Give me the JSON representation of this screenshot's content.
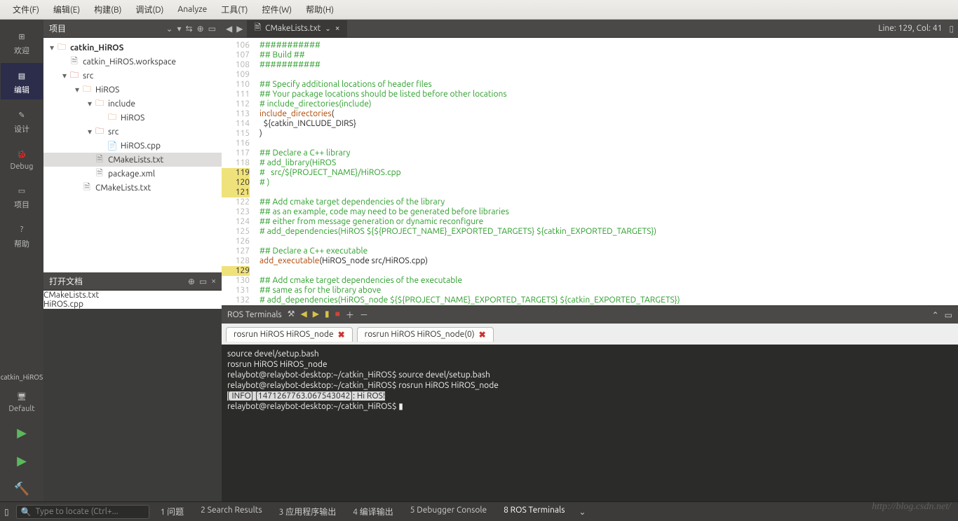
{
  "menubar": [
    "文件(F)",
    "编辑(E)",
    "构建(B)",
    "调试(D)",
    "Analyze",
    "工具(T)",
    "控件(W)",
    "帮助(H)"
  ],
  "leftbar": {
    "items": [
      "欢迎",
      "编辑",
      "设计",
      "Debug",
      "项目",
      "帮助"
    ],
    "project_label": "catkin_HiROS",
    "config_label": "Default"
  },
  "project_panel": {
    "title": "项目"
  },
  "tree": [
    {
      "d": 0,
      "exp": "▾",
      "ic": "fold-o",
      "t": "catkin_HiROS",
      "bold": true
    },
    {
      "d": 1,
      "exp": "",
      "ic": "fil",
      "t": "catkin_HiROS.workspace"
    },
    {
      "d": 1,
      "exp": "▾",
      "ic": "fold-r",
      "t": "src"
    },
    {
      "d": 2,
      "exp": "▾",
      "ic": "fold-o",
      "t": "HiROS"
    },
    {
      "d": 3,
      "exp": "▾",
      "ic": "fold-o",
      "t": "include"
    },
    {
      "d": 4,
      "exp": "",
      "ic": "fold-o",
      "t": "HiROS"
    },
    {
      "d": 3,
      "exp": "▾",
      "ic": "fold-r",
      "t": "src"
    },
    {
      "d": 4,
      "exp": "",
      "ic": "cpp",
      "t": "HiROS.cpp"
    },
    {
      "d": 3,
      "exp": "",
      "ic": "fil",
      "t": "CMakeLists.txt",
      "sel": true
    },
    {
      "d": 3,
      "exp": "",
      "ic": "fil",
      "t": "package.xml"
    },
    {
      "d": 2,
      "exp": "",
      "ic": "fil",
      "t": "CMakeLists.txt"
    }
  ],
  "open_docs": {
    "title": "打开文档",
    "items": [
      "CMakeLists.txt",
      "HiROS.cpp"
    ]
  },
  "tab": {
    "name": "CMakeLists.txt"
  },
  "status": {
    "text": "Line: 129, Col: 41"
  },
  "code": {
    "first_line": 106,
    "yellow": [
      119,
      120,
      121,
      129
    ],
    "lines": [
      {
        "cls": "c-cmt",
        "t": "###########"
      },
      {
        "cls": "c-cmt",
        "t": "## Build ##"
      },
      {
        "cls": "c-cmt",
        "t": "###########"
      },
      {
        "cls": "",
        "t": ""
      },
      {
        "cls": "c-cmt",
        "t": "## Specify additional locations of header files"
      },
      {
        "cls": "c-cmt",
        "t": "## Your package locations should be listed before other locations"
      },
      {
        "cls": "c-cmt",
        "t": "# include_directories(include)"
      },
      {
        "cls": "",
        "t": "",
        "frag": [
          {
            "c": "c-kw",
            "t": "include_directories"
          },
          {
            "c": "",
            "t": "("
          }
        ]
      },
      {
        "cls": "",
        "t": "  ${catkin_INCLUDE_DIRS}"
      },
      {
        "cls": "",
        "t": ")"
      },
      {
        "cls": "",
        "t": ""
      },
      {
        "cls": "c-cmt",
        "t": "## Declare a C++ library"
      },
      {
        "cls": "c-cmt",
        "t": "# add_library(HiROS"
      },
      {
        "cls": "c-cmt",
        "t": "#   src/${PROJECT_NAME}/HiROS.cpp"
      },
      {
        "cls": "c-cmt",
        "t": "# )"
      },
      {
        "cls": "",
        "t": ""
      },
      {
        "cls": "c-cmt",
        "t": "## Add cmake target dependencies of the library"
      },
      {
        "cls": "c-cmt",
        "t": "## as an example, code may need to be generated before libraries"
      },
      {
        "cls": "c-cmt",
        "t": "## either from message generation or dynamic reconfigure"
      },
      {
        "cls": "c-cmt",
        "t": "# add_dependencies(HiROS ${${PROJECT_NAME}_EXPORTED_TARGETS} ${catkin_EXPORTED_TARGETS})"
      },
      {
        "cls": "",
        "t": ""
      },
      {
        "cls": "c-cmt",
        "t": "## Declare a C++ executable"
      },
      {
        "cls": "",
        "t": "",
        "frag": [
          {
            "c": "c-kw",
            "t": "add_executable"
          },
          {
            "c": "",
            "t": "(HiROS_node src/HiROS.cpp)"
          }
        ]
      },
      {
        "cls": "",
        "t": ""
      },
      {
        "cls": "c-cmt",
        "t": "## Add cmake target dependencies of the executable"
      },
      {
        "cls": "c-cmt",
        "t": "## same as for the library above"
      },
      {
        "cls": "c-cmt",
        "t": "# add_dependencies(HiROS_node ${${PROJECT_NAME}_EXPORTED_TARGETS} ${catkin_EXPORTED_TARGETS})"
      }
    ]
  },
  "terminal": {
    "title": "ROS Terminals",
    "tabs": [
      {
        "label": "rosrun HiROS HiROS_node",
        "close": "×"
      },
      {
        "label": "rosrun HiROS HiROS_node(0)",
        "close": "×",
        "active": true
      }
    ],
    "lines": [
      "source devel/setup.bash",
      "rosrun HiROS HiROS_node",
      "relaybot@relaybot-desktop:~/catkin_HiROS$ source devel/setup.bash",
      "relaybot@relaybot-desktop:~/catkin_HiROS$ rosrun HiROS HiROS_node",
      {
        "hl": true,
        "t": "[ INFO] [1471267763.067543042]: Hi ROS!"
      },
      "relaybot@relaybot-desktop:~/catkin_HiROS$ ▮"
    ]
  },
  "bottombar": {
    "placeholder": "Type to locate (Ctrl+...",
    "tabs": [
      "1 问题",
      "2 Search Results",
      "3 应用程序输出",
      "4 编译输出",
      "5 Debugger Console",
      "8 ROS Terminals"
    ]
  },
  "watermark": "http://blog.csdn.net/"
}
